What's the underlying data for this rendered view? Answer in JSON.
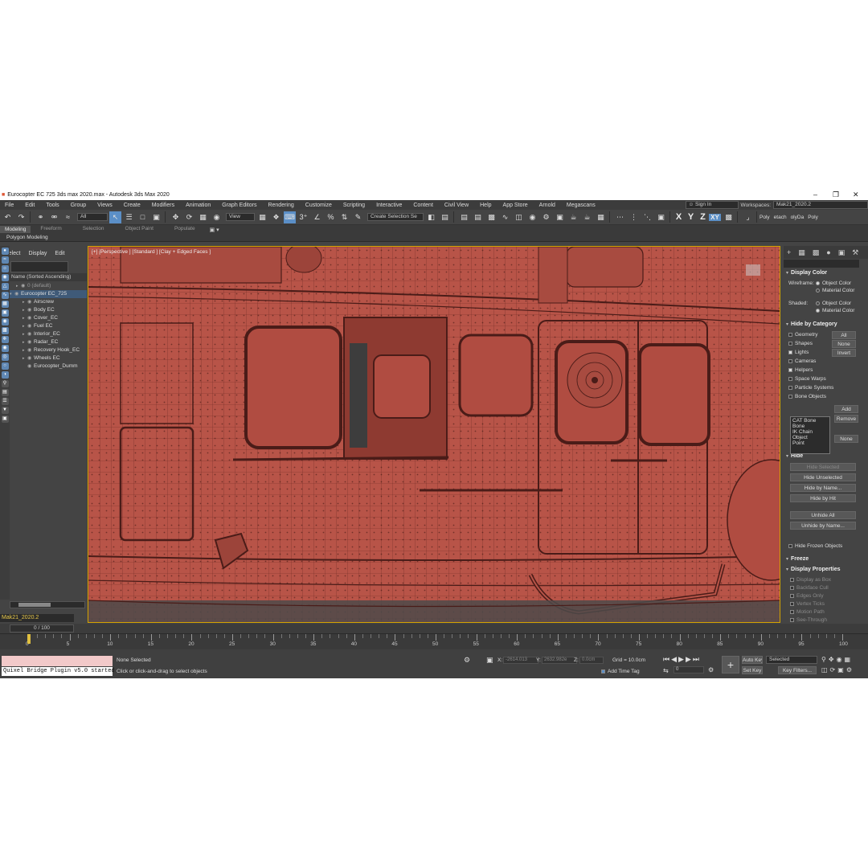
{
  "window": {
    "title": "Eurocopter EC 725 3ds max 2020.max - Autodesk 3ds Max 2020"
  },
  "menu": {
    "items": [
      "File",
      "Edit",
      "Tools",
      "Group",
      "Views",
      "Create",
      "Modifiers",
      "Animation",
      "Graph Editors",
      "Rendering",
      "Customize",
      "Scripting",
      "Interactive",
      "Content",
      "Civil View",
      "Help",
      "App Store",
      "Arnold",
      "Megascans"
    ],
    "sign_in": "Sign In",
    "workspaces_label": "Workspaces:",
    "workspace_value": "Mak21_2020.2"
  },
  "toolbar": {
    "filter_value": "All",
    "ref_coord": "View",
    "selection_set": "Create Selection Se",
    "axis_x": "X",
    "axis_y": "Y",
    "axis_z": "Z",
    "axis_xy": "XY",
    "right_tabs": [
      "Poly",
      "etach",
      "olyDa",
      "Poly"
    ]
  },
  "ribbon": {
    "tabs": [
      "Modeling",
      "Freeform",
      "Selection",
      "Object Paint",
      "Populate"
    ],
    "sub": "Polygon Modeling"
  },
  "scene_explorer": {
    "menu": [
      "Select",
      "Display",
      "Edit"
    ],
    "column_header": "Name (Sorted Ascending)",
    "nodes": [
      {
        "label": "0 (default)",
        "depth": 1,
        "dim": true
      },
      {
        "label": "Eurocopter EC_725",
        "depth": 0,
        "selected": true
      },
      {
        "label": "Airscrew",
        "depth": 2
      },
      {
        "label": "Body EC",
        "depth": 2
      },
      {
        "label": "Cover_EC",
        "depth": 2
      },
      {
        "label": "Fuel EC",
        "depth": 2
      },
      {
        "label": "Interior_EC",
        "depth": 2
      },
      {
        "label": "Radar_EC",
        "depth": 2
      },
      {
        "label": "Recovery Hook_EC",
        "depth": 2
      },
      {
        "label": "Wheels EC",
        "depth": 2
      },
      {
        "label": "Eurocopter_Dumm",
        "depth": 2
      }
    ],
    "layer": "Mak21_2020.2"
  },
  "viewport": {
    "label": "[+] [Perspective ] [Standard ] [Clay + Edged Faces ]"
  },
  "command_panel": {
    "display_color": {
      "title": "Display Color",
      "wireframe_label": "Wireframe:",
      "shaded_label": "Shaded:",
      "object_color": "Object Color",
      "material_color": "Material Color"
    },
    "hide_by_category": {
      "title": "Hide by Category",
      "items": [
        "Geometry",
        "Shapes",
        "Lights",
        "Cameras",
        "Helpers",
        "Space Warps",
        "Particle Systems",
        "Bone Objects"
      ],
      "buttons": [
        "All",
        "None",
        "Invert"
      ],
      "list_items": [
        "CAT Bone",
        "Bone",
        "IK Chain Object",
        "Point"
      ],
      "add": "Add",
      "remove": "Remove",
      "none": "None"
    },
    "hide": {
      "title": "Hide",
      "buttons": [
        "Hide Selected",
        "Hide Unselected",
        "Hide by Name...",
        "Hide by Hit",
        "Unhide All",
        "Unhide by Name..."
      ],
      "frozen": "Hide Frozen Objects"
    },
    "freeze": {
      "title": "Freeze"
    },
    "display_properties": {
      "title": "Display Properties",
      "items": [
        "Display as Box",
        "Backface Cull",
        "Edges Only",
        "Vertex Ticks",
        "Motion Path",
        "See-Through"
      ]
    }
  },
  "timeline": {
    "slider": "0 / 100",
    "ticks": [
      "0",
      "5",
      "10",
      "15",
      "20",
      "25",
      "30",
      "35",
      "40",
      "45",
      "50",
      "55",
      "60",
      "65",
      "70",
      "75",
      "80",
      "85",
      "90",
      "95",
      "100"
    ]
  },
  "status": {
    "maxscript_output": "Quixel Bridge Plugin v5.0 started",
    "none_selected": "None Selected",
    "prompt": "Click or click-and-drag to select objects",
    "x_label": "X:",
    "x_value": "-2614.013",
    "y_label": "Y:",
    "y_value": "2632.982e",
    "z_label": "Z:",
    "z_value": "0.0cm",
    "grid": "Grid = 10.0cm",
    "add_time_tag": "Add Time Tag",
    "auto_key": "Auto Key",
    "set_key": "Set Key",
    "selected": "Selected",
    "key_filters": "Key Filters...",
    "frame": "0"
  }
}
